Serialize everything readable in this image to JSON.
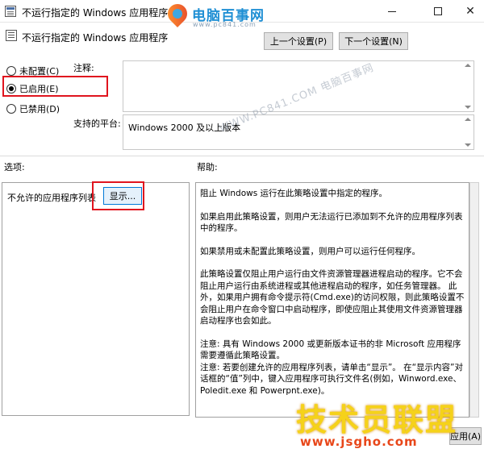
{
  "window": {
    "title": "不运行指定的 Windows 应用程序"
  },
  "watermarks": {
    "logo_name": "电脑百事网",
    "logo_site": "www.pc841.com",
    "diagonal": "WWW.PC841.COM 电脑百事网",
    "bottom_name": "技术员联盟",
    "bottom_url": "www.jsgho.com"
  },
  "header": {
    "policy_title": "不运行指定的 Windows 应用程序",
    "prev_button": "上一个设置(P)",
    "next_button": "下一个设置(N)"
  },
  "state": {
    "options": [
      {
        "label": "未配置(C)",
        "checked": false
      },
      {
        "label": "已启用(E)",
        "checked": true
      },
      {
        "label": "已禁用(D)",
        "checked": false
      }
    ]
  },
  "comment": {
    "label": "注释:",
    "value": ""
  },
  "platform": {
    "label": "支持的平台:",
    "value": "Windows 2000 及以上版本"
  },
  "options_section": {
    "label": "选项:",
    "item_label": "不允许的应用程序列表",
    "show_button": "显示..."
  },
  "help_section": {
    "label": "帮助:",
    "paragraphs": [
      "阻止 Windows 运行在此策略设置中指定的程序。",
      "如果启用此策略设置，则用户无法运行已添加到不允许的应用程序列表中的程序。",
      "如果禁用或未配置此策略设置，则用户可以运行任何程序。",
      "此策略设置仅阻止用户运行由文件资源管理器进程启动的程序。它不会阻止用户运行由系统进程或其他进程启动的程序，如任务管理器。 此外，如果用户拥有命令提示符(Cmd.exe)的访问权限，则此策略设置不会阻止用户在命令窗口中启动程序，即使应阻止其使用文件资源管理器启动程序也会如此。",
      "注意: 具有 Windows 2000 或更新版本证书的非 Microsoft 应用程序需要遵循此策略设置。",
      "注意: 若要创建允许的应用程序列表，请单击“显示”。 在“显示内容”对话框的“值”列中，键入应用程序可执行文件名(例如，Winword.exe、Poledit.exe 和 Powerpnt.exe)。"
    ]
  },
  "footer": {
    "apply_button": "应用(A)"
  },
  "colors": {
    "highlight_box": "#e0141e",
    "button_face": "#e1e1e1",
    "focused_button_border": "#0078d7"
  }
}
